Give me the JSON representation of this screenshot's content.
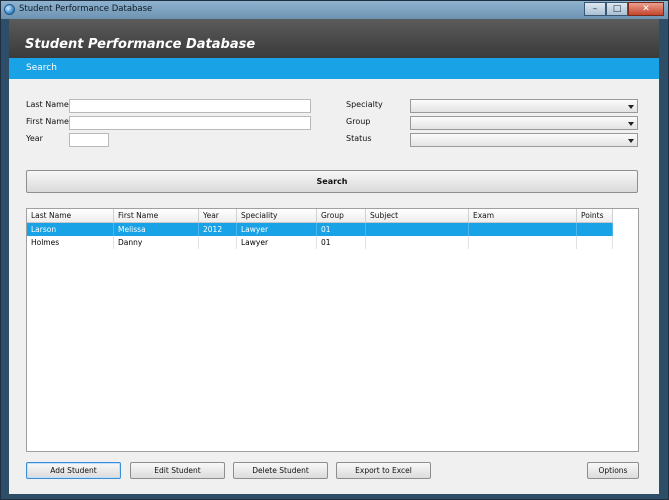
{
  "window": {
    "title": "Student Performance Database",
    "controls": {
      "minimize": "–",
      "maximize": "□",
      "close": "✕"
    }
  },
  "header": {
    "title": "Student Performance Database"
  },
  "tabs": [
    {
      "label": "Search",
      "active": true
    }
  ],
  "search_form": {
    "last_name": {
      "label": "Last Name",
      "value": ""
    },
    "first_name": {
      "label": "First Name",
      "value": ""
    },
    "year": {
      "label": "Year",
      "value": ""
    },
    "specialty": {
      "label": "Specialty",
      "value": ""
    },
    "group": {
      "label": "Group",
      "value": ""
    },
    "status": {
      "label": "Status",
      "value": ""
    },
    "search_button": "Search"
  },
  "table": {
    "columns": [
      "Last Name",
      "First Name",
      "Year",
      "Speciality",
      "Group",
      "Subject",
      "Exam",
      "Points"
    ],
    "rows": [
      [
        "Larson",
        "Melissa",
        "2012",
        "Lawyer",
        "01",
        "",
        "",
        ""
      ],
      [
        "Holmes",
        "Danny",
        "",
        "Lawyer",
        "01",
        "",
        "",
        ""
      ]
    ],
    "selected_row": 0
  },
  "actions": {
    "add_student": "Add Student",
    "edit_student": "Edit Student",
    "delete_student": "Delete Student",
    "export_to_excel": "Export to Excel",
    "options": "Options"
  },
  "colors": {
    "accent": "#1aa2e6",
    "header_band": "#444444",
    "window_frame": "#2e4e68"
  }
}
